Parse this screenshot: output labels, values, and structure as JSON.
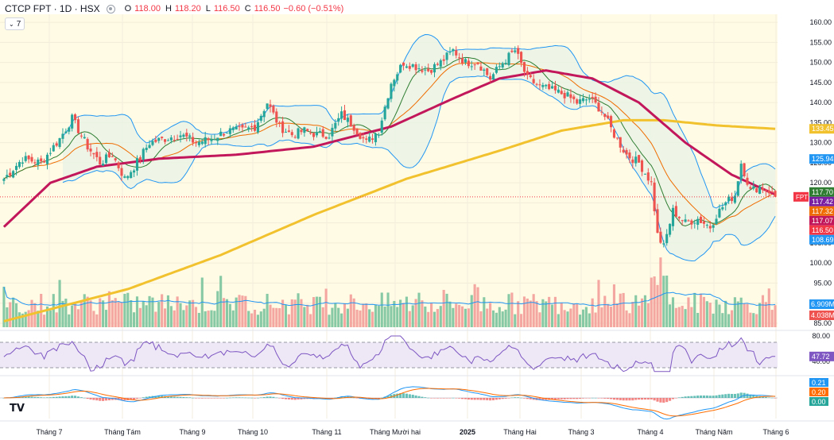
{
  "header": {
    "symbol": "CTCP FPT · 1D · HSX",
    "open_label": "O",
    "open": "118.00",
    "high_label": "H",
    "high": "118.20",
    "low_label": "L",
    "low": "116.50",
    "close_label": "C",
    "close": "116.50",
    "change": "−0.60 (−0.51%)",
    "indicators_toggle": "7"
  },
  "colors": {
    "up": "#26a69a",
    "down": "#ef5350",
    "vol_up": "#86c9a4",
    "vol_down": "#f4a6a0",
    "ma50": "#c2185b",
    "ma200": "#f2c12e",
    "bb": "#2196f3",
    "bb_fill": "#e8f3e6",
    "ma_fast": "#ef6c00",
    "ma_mid": "#2e7d32",
    "rsi": "#7e57c2",
    "rsi_band": "#ede7f6",
    "macd": "#2196f3",
    "macd_signal": "#ff6d00",
    "price_area_bg": "#fffbe5"
  },
  "logo_icon": "tradingview-logo-icon",
  "chart_data": {
    "type": "candlestick",
    "title": "CTCP FPT · 1D · HSX",
    "x_labels": [
      "Tháng 7",
      "Tháng Tám",
      "Tháng 9",
      "Tháng 10",
      "Tháng 11",
      "Tháng Mười hai",
      "2025",
      "Tháng Hai",
      "Tháng 3",
      "Tháng 4",
      "Tháng Năm",
      "Tháng 6"
    ],
    "price_ticks": [
      85.0,
      90.0,
      95.0,
      100.0,
      105.0,
      110.0,
      115.0,
      120.0,
      125.0,
      130.0,
      135.0,
      140.0,
      145.0,
      150.0,
      155.0,
      160.0
    ],
    "price_ylim": [
      84,
      162
    ],
    "price_tick_labels": [
      "85.00",
      "90.00",
      "95.00",
      "100.00",
      "105.00",
      "110.00",
      "115.00",
      "120.00",
      "125.00",
      "130.00",
      "135.00",
      "140.00",
      "145.00",
      "150.00",
      "155.00",
      "160.00"
    ],
    "close_path": [
      {
        "bar": 0,
        "v": 121
      },
      {
        "bar": 6,
        "v": 126
      },
      {
        "bar": 12,
        "v": 125
      },
      {
        "bar": 18,
        "v": 131
      },
      {
        "bar": 22,
        "v": 136
      },
      {
        "bar": 27,
        "v": 129
      },
      {
        "bar": 31,
        "v": 125
      },
      {
        "bar": 35,
        "v": 127
      },
      {
        "bar": 39,
        "v": 121
      },
      {
        "bar": 42,
        "v": 124
      },
      {
        "bar": 47,
        "v": 130
      },
      {
        "bar": 52,
        "v": 131
      },
      {
        "bar": 57,
        "v": 132
      },
      {
        "bar": 62,
        "v": 130
      },
      {
        "bar": 67,
        "v": 131
      },
      {
        "bar": 72,
        "v": 133
      },
      {
        "bar": 77,
        "v": 133
      },
      {
        "bar": 81,
        "v": 134
      },
      {
        "bar": 85,
        "v": 140
      },
      {
        "bar": 89,
        "v": 134
      },
      {
        "bar": 93,
        "v": 132
      },
      {
        "bar": 97,
        "v": 133
      },
      {
        "bar": 101,
        "v": 132
      },
      {
        "bar": 105,
        "v": 132
      },
      {
        "bar": 109,
        "v": 137
      },
      {
        "bar": 113,
        "v": 134
      },
      {
        "bar": 117,
        "v": 130
      },
      {
        "bar": 121,
        "v": 133
      },
      {
        "bar": 125,
        "v": 145
      },
      {
        "bar": 129,
        "v": 150
      },
      {
        "bar": 133,
        "v": 149
      },
      {
        "bar": 137,
        "v": 148
      },
      {
        "bar": 141,
        "v": 150
      },
      {
        "bar": 145,
        "v": 153
      },
      {
        "bar": 149,
        "v": 150
      },
      {
        "bar": 153,
        "v": 150
      },
      {
        "bar": 157,
        "v": 146
      },
      {
        "bar": 161,
        "v": 150
      },
      {
        "bar": 165,
        "v": 153
      },
      {
        "bar": 169,
        "v": 146
      },
      {
        "bar": 173,
        "v": 144
      },
      {
        "bar": 177,
        "v": 143
      },
      {
        "bar": 181,
        "v": 142
      },
      {
        "bar": 185,
        "v": 140
      },
      {
        "bar": 189,
        "v": 141
      },
      {
        "bar": 193,
        "v": 138
      },
      {
        "bar": 197,
        "v": 132
      },
      {
        "bar": 201,
        "v": 127
      },
      {
        "bar": 205,
        "v": 125
      },
      {
        "bar": 209,
        "v": 120
      },
      {
        "bar": 211,
        "v": 107
      },
      {
        "bar": 213,
        "v": 104
      },
      {
        "bar": 216,
        "v": 113
      },
      {
        "bar": 220,
        "v": 110
      },
      {
        "bar": 224,
        "v": 111
      },
      {
        "bar": 228,
        "v": 109
      },
      {
        "bar": 230,
        "v": 112
      },
      {
        "bar": 233,
        "v": 115
      },
      {
        "bar": 236,
        "v": 117
      },
      {
        "bar": 238,
        "v": 125
      },
      {
        "bar": 241,
        "v": 118
      },
      {
        "bar": 244,
        "v": 119
      },
      {
        "bar": 247,
        "v": 118
      },
      {
        "bar": 249,
        "v": 116.5
      }
    ],
    "bar_count": 250,
    "ma200": [
      {
        "bar": 0,
        "v": 85.5
      },
      {
        "bar": 40,
        "v": 93.5
      },
      {
        "bar": 70,
        "v": 102
      },
      {
        "bar": 100,
        "v": 112
      },
      {
        "bar": 130,
        "v": 121
      },
      {
        "bar": 160,
        "v": 128
      },
      {
        "bar": 180,
        "v": 133
      },
      {
        "bar": 200,
        "v": 135.6
      },
      {
        "bar": 213,
        "v": 135.6
      },
      {
        "bar": 230,
        "v": 134.3
      },
      {
        "bar": 249,
        "v": 133.45
      }
    ],
    "ma50": [
      {
        "bar": 0,
        "v": 109
      },
      {
        "bar": 15,
        "v": 120
      },
      {
        "bar": 30,
        "v": 124
      },
      {
        "bar": 50,
        "v": 126
      },
      {
        "bar": 75,
        "v": 127
      },
      {
        "bar": 100,
        "v": 129
      },
      {
        "bar": 125,
        "v": 134
      },
      {
        "bar": 145,
        "v": 141
      },
      {
        "bar": 160,
        "v": 146
      },
      {
        "bar": 175,
        "v": 148
      },
      {
        "bar": 190,
        "v": 146
      },
      {
        "bar": 205,
        "v": 140
      },
      {
        "bar": 220,
        "v": 130
      },
      {
        "bar": 235,
        "v": 122
      },
      {
        "bar": 249,
        "v": 117.07
      }
    ],
    "bollinger_upper_last": 125.94,
    "bollinger_lower_last": 108.69,
    "price_labels": [
      {
        "value": 133.45,
        "text": "133.45",
        "color": "#f2c12e"
      },
      {
        "value": 125.94,
        "text": "125.94",
        "color": "#2196f3"
      },
      {
        "value": 117.7,
        "text": "117.70",
        "color": "#2e7d32"
      },
      {
        "value": 117.42,
        "text": "117.42",
        "color": "#7b1fa2"
      },
      {
        "value": 117.32,
        "text": "117.32",
        "color": "#ef6c00"
      },
      {
        "value": 117.07,
        "text": "117.07",
        "color": "#c2185b"
      },
      {
        "value": 116.5,
        "text": "116.50",
        "color": "#f23645"
      },
      {
        "value": 108.69,
        "text": "108.69",
        "color": "#2196f3"
      }
    ],
    "symbol_tag": "FPT",
    "volume": {
      "last": "4.038M",
      "ma_last": "6.909M",
      "ma_color": "#2196f3",
      "last_color": "#ef5350"
    },
    "rsi": {
      "ticks": [
        "80.00",
        "40.00"
      ],
      "tick_values": [
        80,
        40
      ],
      "ylim": [
        20,
        85
      ],
      "band": [
        30,
        70
      ],
      "last": 47.72,
      "last_text": "47.72"
    },
    "macd": {
      "ticks": [
        "0.00"
      ],
      "labels": [
        {
          "text": "0.21",
          "color": "#2196f3"
        },
        {
          "text": "0.20",
          "color": "#ff6d00"
        },
        {
          "text": "0.00",
          "color": "#26a69a"
        }
      ]
    }
  }
}
